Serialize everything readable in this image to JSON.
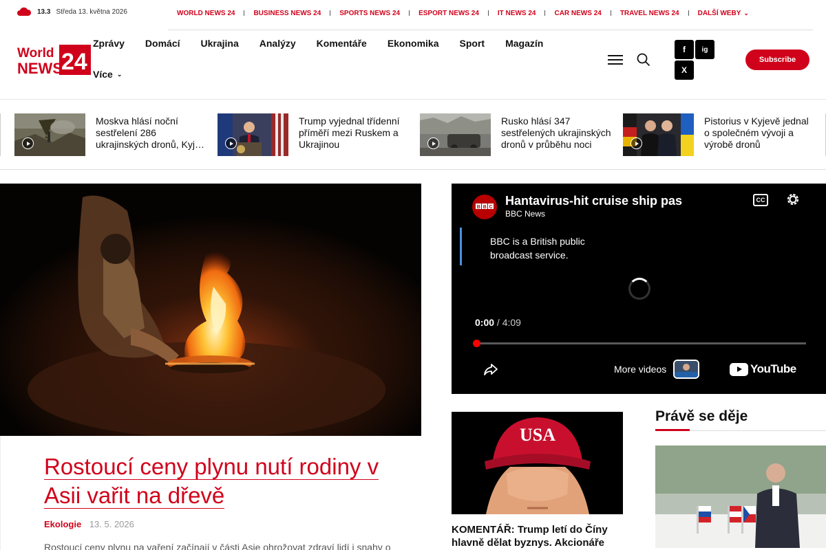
{
  "weather": {
    "temp": "13.3",
    "date": "Středa 13. května 2026"
  },
  "network_sites": [
    {
      "label": "WORLD NEWS 24"
    },
    {
      "label": "BUSINESS NEWS 24"
    },
    {
      "label": "SPORTS NEWS 24"
    },
    {
      "label": "ESPORT NEWS 24"
    },
    {
      "label": "IT NEWS 24"
    },
    {
      "label": "CAR NEWS 24"
    },
    {
      "label": "TRAVEL NEWS 24"
    },
    {
      "label": "DALŠÍ WEBY"
    }
  ],
  "logo": {
    "line1": "World",
    "line2": "NEWS",
    "num": "24"
  },
  "nav": {
    "items": [
      "Zprávy",
      "Domácí",
      "Ukrajina",
      "Analýzy",
      "Komentáře",
      "Ekonomika",
      "Sport",
      "Magazín"
    ],
    "more": "Více"
  },
  "social": {
    "facebook": "f",
    "instagram": "ig",
    "x": "X"
  },
  "subscribe_label": "Subscribe",
  "ticker": [
    {
      "title": "Moskva hlásí noční sestřelení 286 ukrajinských dronů, Kyj…"
    },
    {
      "title": "Trump vyjednal třídenní příměří mezi Ruskem a Ukrajinou"
    },
    {
      "title": "Rusko hlásí 347 sestřelených ukrajinských dronů v průběhu noci"
    },
    {
      "title": "Pistorius v Kyjevě jednal o společném vývoji a výrobě dronů"
    }
  ],
  "main_article": {
    "title": "Rostoucí ceny plynu nutí rodiny v Asii vařit na dřevě",
    "category": "Ekologie",
    "date": "13. 5. 2026",
    "excerpt": "Rostoucí ceny plynu na vaření začínají v části Asie ohrožovat zdraví lidí i snahy o"
  },
  "video": {
    "title": "Hantavirus-hit cruise ship pas",
    "channel": "BBC News",
    "note": "BBC is a British public broadcast service.",
    "current_time": "0:00",
    "duration": "4:09",
    "cc_label": "CC",
    "more_videos": "More videos",
    "youtube": "YouTube",
    "progress": 0
  },
  "comment_card": {
    "title": "KOMENTÁŘ: Trump letí do Číny hlavně dělat byznys. Akcionáře",
    "cap_text": "USA"
  },
  "happening_now": {
    "heading": "Právě se děje"
  },
  "colors": {
    "accent": "#d0021b",
    "text": "#111111",
    "video_bg": "#000000"
  }
}
